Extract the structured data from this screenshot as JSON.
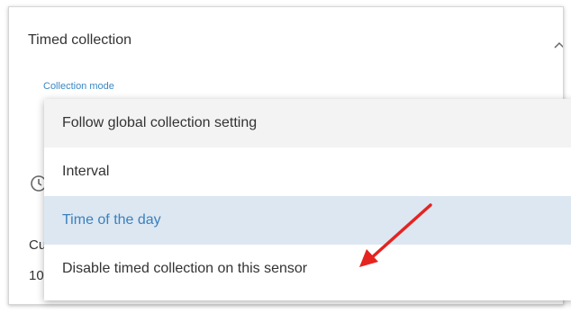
{
  "section": {
    "title": "Timed collection",
    "field_label": "Collection mode"
  },
  "behind": {
    "partial_text_1": "Cu",
    "partial_text_2": "10"
  },
  "dropdown": {
    "options": [
      {
        "label": "Follow global collection setting",
        "state": "hover"
      },
      {
        "label": "Interval",
        "state": "normal"
      },
      {
        "label": "Time of the day",
        "state": "selected"
      },
      {
        "label": "Disable timed collection on this sensor",
        "state": "normal"
      }
    ]
  },
  "annotation": {
    "arrow_color": "#e52420"
  },
  "colors": {
    "accent": "#3a88c4",
    "selected_bg": "#dce7f2",
    "hover_bg": "#f3f3f3"
  }
}
